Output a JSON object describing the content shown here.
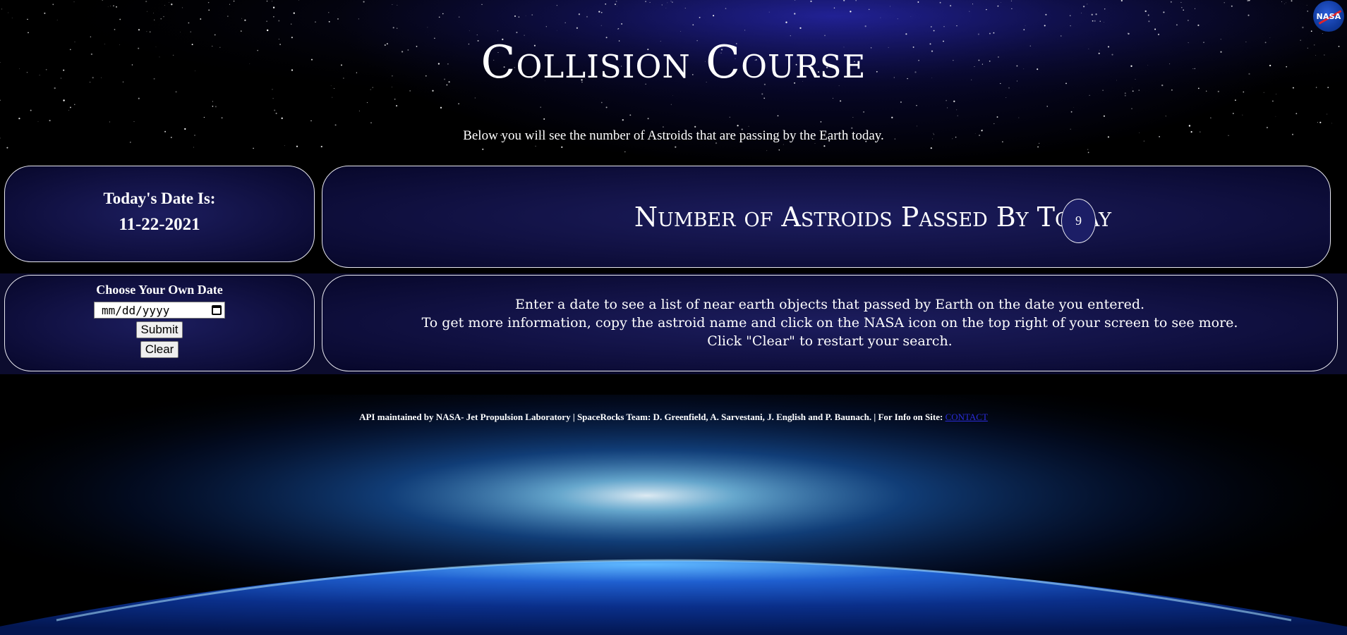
{
  "header": {
    "title": "Collision Course",
    "subtitle": "Below you will see the number of Astroids that are passing by the Earth today.",
    "nasa_logo_text": "NASA"
  },
  "today": {
    "label": "Today's Date Is:",
    "date": "11-22-2021"
  },
  "asteroid_count": {
    "label": "Number of Astroids Passed By Today",
    "count": "9"
  },
  "date_picker": {
    "label": "Choose Your Own Date",
    "placeholder": "mm/dd/yyyy",
    "submit_label": "Submit",
    "clear_label": "Clear"
  },
  "instructions": {
    "line1": "Enter a date to see a list of near earth objects that passed by Earth on the date you entered.",
    "line2": "To get more information, copy the astroid name and click on the NASA icon on the top right of your screen to see more.",
    "line3": "Click \"Clear\" to restart your search."
  },
  "footer": {
    "text": "API maintained by NASA- Jet Propulsion Laboratory | SpaceRocks Team: D. Greenfield, A. Sarvestani, J. English and P. Baunach. | For Info on Site: ",
    "contact_label": "CONTACT"
  },
  "colors": {
    "panel_center": "#1c1d5e",
    "link": "#2b2bd9",
    "badge": "#1c1e66"
  },
  "icons": {
    "logo": "nasa-logo-icon",
    "calendar": "calendar-icon"
  }
}
